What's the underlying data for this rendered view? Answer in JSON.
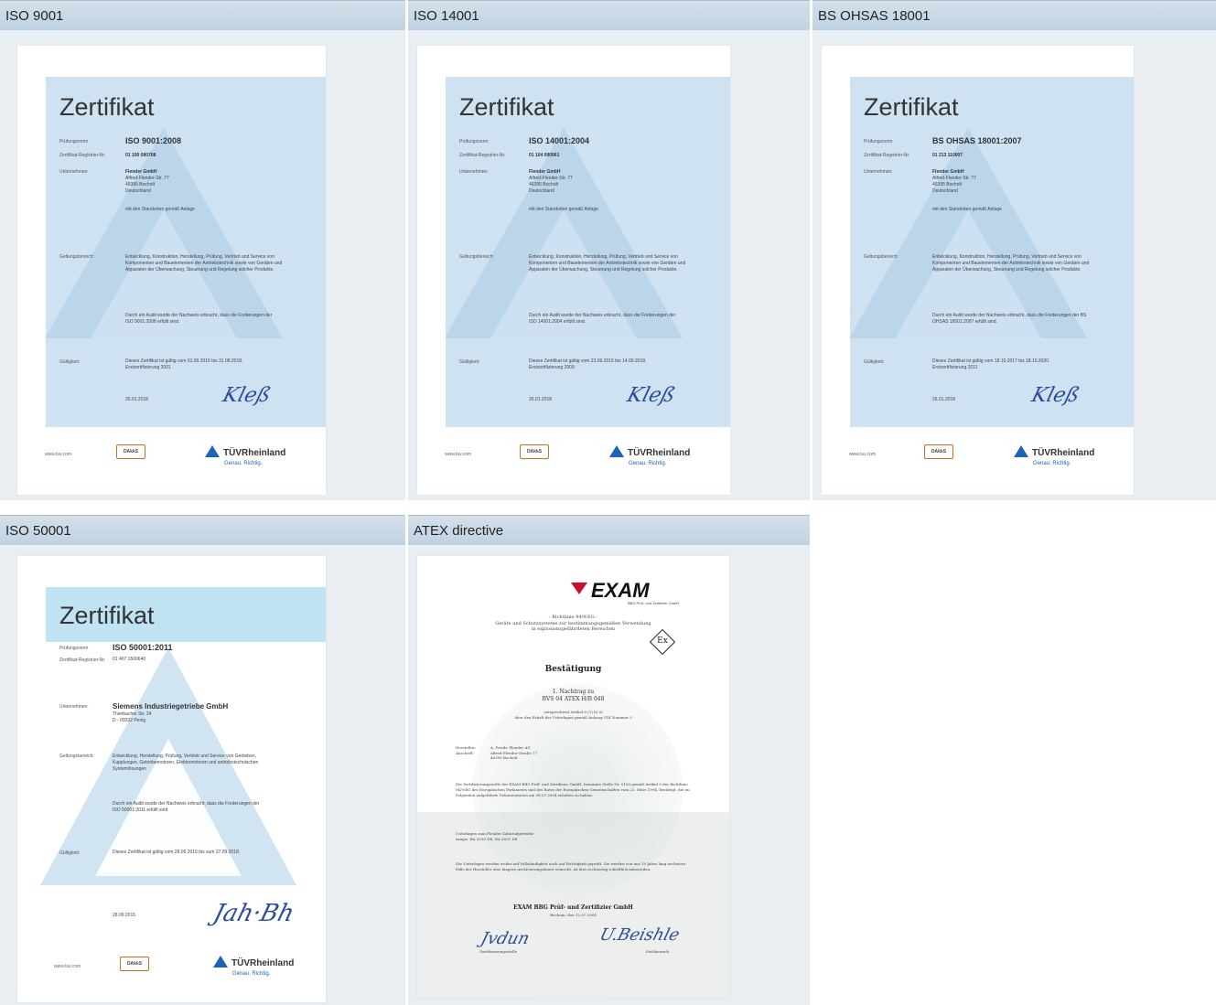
{
  "certificates": [
    {
      "header": "ISO 9001",
      "title": "Zertifikat",
      "norm_label": "Prüfungsnorm",
      "norm": "ISO 9001:2008",
      "reg_label": "Zertifikat-Registrier-Nr.",
      "reg": "01 100 080708",
      "company_label": "Unternehmen:",
      "company": "Flender GmbH",
      "address": "Alfred-Flender-Str. 77\n46395 Bocholt\nDeutschland",
      "sites": "mit den Standorten gemäß Anlage",
      "scope_label": "Geltungsbereich:",
      "scope": "Entwicklung, Konstruktion, Herstellung, Prüfung, Vertrieb und Service von Komponenten und Bauelementen der Antriebstechnik sowie von Geräten und Apparaten der Überwachung, Steuerung und Regelung solcher Produkte.",
      "audit": "Durch ein Audit wurde der Nachweis erbracht, dass die Forderungen der ISO 9001:2008 erfüllt sind.",
      "validity_label": "Gültigkeit:",
      "validity": "Dieses Zertifikat ist gültig vom 01.09.2015 bis 31.08.2018.\nErstzertifizierung 2001",
      "date": "26.01.2018",
      "url": "www.tuv.com",
      "tuv": "TÜVRheinland",
      "tagline": "Genau. Richtig."
    },
    {
      "header": "ISO 14001",
      "title": "Zertifikat",
      "norm_label": "Prüfungsnorm",
      "norm": "ISO 14001:2004",
      "reg_label": "Zertifikat-Registrier-Nr.",
      "reg": "01 104 090961",
      "company_label": "Unternehmen:",
      "company": "Flender GmbH",
      "address": "Alfred-Flender-Str. 77\n46395 Bocholt\nDeutschland",
      "sites": "mit den Standorten gemäß Anlage",
      "scope_label": "Geltungsbereich:",
      "scope": "Entwicklung, Konstruktion, Herstellung, Prüfung, Vertrieb und Service von Komponenten und Bauelementen der Antriebstechnik sowie von Geräten und Apparaten der Überwachung, Steuerung und Regelung solcher Produkte.",
      "audit": "Durch ein Audit wurde der Nachweis erbracht, dass die Forderungen der ISO 14001:2004 erfüllt sind.",
      "validity_label": "Gültigkeit:",
      "validity": "Dieses Zertifikat ist gültig vom 23.09.2015 bis 14.09.2018.\nErstzertifizierung 2009",
      "date": "26.01.2018",
      "url": "www.tuv.com",
      "tuv": "TÜVRheinland",
      "tagline": "Genau. Richtig."
    },
    {
      "header": "BS OHSAS 18001",
      "title": "Zertifikat",
      "norm_label": "Prüfungsnorm",
      "norm": "BS OHSAS 18001:2007",
      "reg_label": "Zertifikat-Registrier-Nr.",
      "reg": "01 213 110007",
      "company_label": "Unternehmen:",
      "company": "Flender GmbH",
      "address": "Alfred-Flender-Str. 77\n46395 Bocholt\nDeutschland",
      "sites": "mit den Standorten gemäß Anlage",
      "scope_label": "Geltungsbereich:",
      "scope": "Entwicklung, Konstruktion, Herstellung, Prüfung, Vertrieb und Service von Komponenten und Bauelementen der Antriebstechnik sowie von Geräten und Apparaten der Überwachung, Steuerung und Regelung solcher Produkte.",
      "audit": "Durch ein Audit wurde der Nachweis erbracht, dass die Forderungen der BS OHSAS 18001:2007 erfüllt sind.",
      "validity_label": "Gültigkeit:",
      "validity": "Dieses Zertifikat ist gültig vom 18.10.2017 bis 18.10.2020.\nErstzertifizierung 2011",
      "date": "26.01.2018",
      "url": "www.tuv.com",
      "tuv": "TÜVRheinland",
      "tagline": "Genau. Richtig."
    },
    {
      "header": "ISO 50001",
      "title": "Zertifikat",
      "norm_label": "Prüfungsnorm",
      "norm": "ISO 50001:2011",
      "reg_label": "Zertifikat-Registrier-Nr.",
      "reg": "01 407 1500640",
      "company_label": "Unternehmen:",
      "company": "Siemens Industriegetriebe GmbH",
      "address": "Thierbacher Str. 24\nD - 09322 Penig",
      "sites": "",
      "scope_label": "Geltungsbereich:",
      "scope": "Entwicklung, Herstellung, Prüfung, Vertrieb und Service von Getrieben, Kupplungen, Getriebemotoren, Elektromotoren und antriebstechnischen Systemlösungen",
      "audit": "Durch ein Audit wurde der Nachweis erbracht, dass die Forderungen der ISO 50001:2011 erfüllt sind.",
      "validity_label": "Gültigkeit:",
      "validity": "Dieses Zertifikat ist gültig vom 28.09.2015 bis zum 27.09.2018.",
      "date": "28.09.2015",
      "url": "www.tuv.com",
      "tuv": "TÜVRheinland",
      "tagline": "Genau. Richtig."
    }
  ],
  "atex": {
    "header": "ATEX directive",
    "logo": "EXAM",
    "logo_sub": "BBG Prüf- und Zertifizier GmbH",
    "directive": "- Richtlinie 94/9/EG -",
    "directive_sub": "Geräte und Schutzsysteme zur bestimmungsgemäßen Verwendung\nin explosionsgefährdeten Bereichen",
    "ex": "Ex",
    "title": "Bestätigung",
    "amendment": "1. Nachtrag zu",
    "number": "BVS 04 ATEX H/B 048",
    "article": "entsprechend Artikel 8 (1) b) ii)\nüber den Erhalt der Unterlagen gemäß Anhang VIII Nummer 3",
    "manufacturer_label": "Hersteller:",
    "manufacturer": "A. Friedr. Flender AG",
    "address_label": "Anschrift:",
    "address": "Alfred-Flender-Straße 77\n46395 Bocholt",
    "body": "Die Zertifizierungsstelle der EXAM BBG Prüf- und Zertifizier GmbH, benannte Stelle Nr. 0158 gemäß Artikel 9 der Richtlinie 94/9/EG des Europäischen Parlaments und des Rates der Europäischen Gemeinschaften vom 23. März 1994, bestätigt, die im Folgenden aufgeführte Dokumentation am 08.07.2004 erhalten zu haben:",
    "docs": "Unterlagen zum Flender Zahnradgetriebe\nsampe. BA 5030 DE, BA 5031 DE",
    "archive": "Die Unterlagen werden weder auf Vollständigkeit noch auf Richtigkeit geprüft. Sie werden von uns 10 Jahre lang archiviert. Falls der Hersteller eine längere Archivierungsdauer wünscht, ist dies rechtzeitig schriftlich mitzuteilen.",
    "issuer": "EXAM BBG Prüf- und Zertifizier GmbH",
    "place_date": "Bochum, den 12.07.2004",
    "sig_left_label": "Zertifizierungsstelle",
    "sig_right_label": "Fachbereich"
  }
}
